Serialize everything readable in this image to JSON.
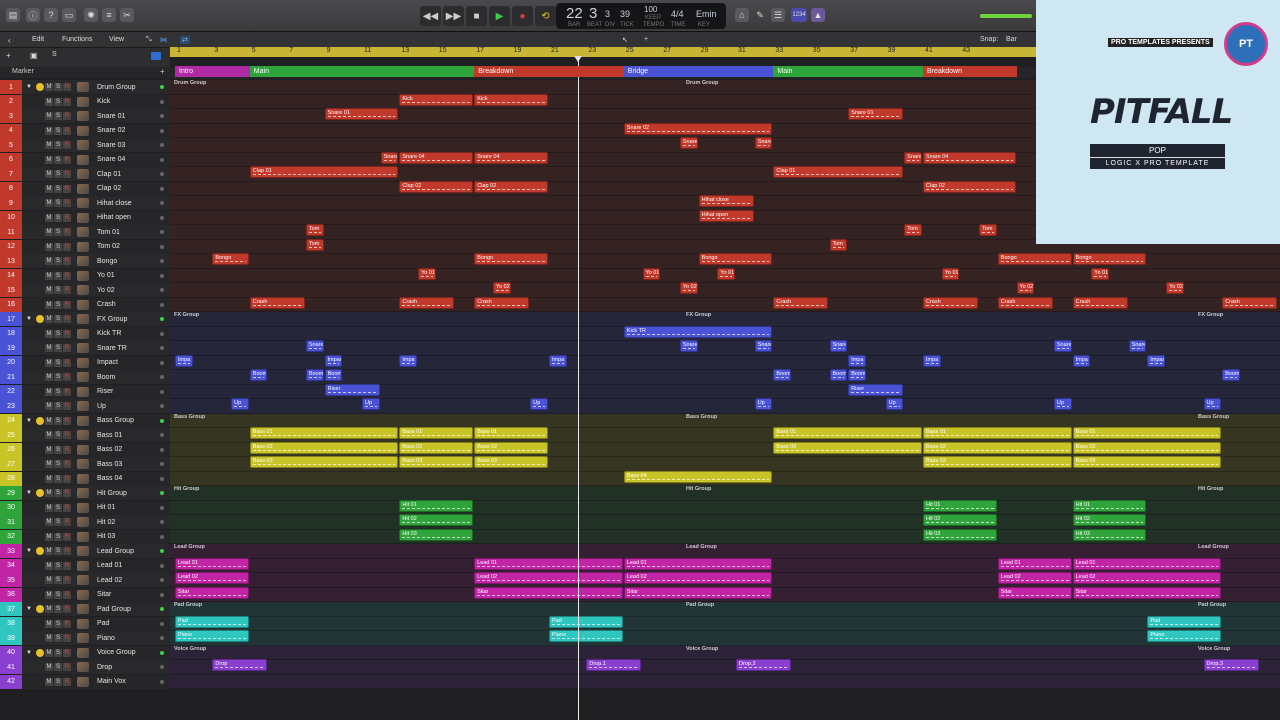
{
  "toolbar": {
    "edit": "Edit",
    "functions": "Functions",
    "view": "View",
    "snap_label": "Snap:",
    "snap_value": "Bar",
    "s_btn": "S"
  },
  "lcd": {
    "bar": "22",
    "beat": "3",
    "div": "3",
    "tick": "39",
    "tempo": "100",
    "tempo_mode": "KEEP",
    "sig": "4/4",
    "key": "Emin",
    "bar_l": "BAR",
    "beat_l": "BEAT",
    "div_l": "DIV",
    "tick_l": "TICK",
    "tempo_l": "TEMPO",
    "time_l": "TIME",
    "key_l": "KEY"
  },
  "cbar": {
    "count_in": "1234"
  },
  "ruler": {
    "labels": [
      "1",
      "3",
      "5",
      "7",
      "9",
      "11",
      "13",
      "15",
      "17",
      "19",
      "21",
      "23",
      "25",
      "27",
      "29",
      "31",
      "33",
      "35",
      "37",
      "39",
      "41",
      "43"
    ],
    "marker_title": "Marker"
  },
  "markers": [
    {
      "label": "Intro",
      "start": 1,
      "end": 5,
      "color": "#b02aa6"
    },
    {
      "label": "Main",
      "start": 5,
      "end": 17,
      "color": "#2ea43a"
    },
    {
      "label": "Breakdown",
      "start": 17,
      "end": 25,
      "color": "#c0392b"
    },
    {
      "label": "Bridge",
      "start": 25,
      "end": 33,
      "color": "#4a52d6"
    },
    {
      "label": "Main",
      "start": 33,
      "end": 41,
      "color": "#2ea43a"
    },
    {
      "label": "Breakdown",
      "start": 41,
      "end": 46,
      "color": "#c0392b"
    }
  ],
  "tracks": [
    {
      "n": "1",
      "name": "Drum Group",
      "c": "#c0392b",
      "folder": true
    },
    {
      "n": "2",
      "name": "Kick",
      "c": "#c0392b"
    },
    {
      "n": "3",
      "name": "Snare 01",
      "c": "#c0392b"
    },
    {
      "n": "4",
      "name": "Snare 02",
      "c": "#c0392b"
    },
    {
      "n": "5",
      "name": "Snare 03",
      "c": "#c0392b"
    },
    {
      "n": "6",
      "name": "Snare 04",
      "c": "#c0392b"
    },
    {
      "n": "7",
      "name": "Clap 01",
      "c": "#c0392b"
    },
    {
      "n": "8",
      "name": "Clap 02",
      "c": "#c0392b"
    },
    {
      "n": "9",
      "name": "Hihat close",
      "c": "#c0392b"
    },
    {
      "n": "10",
      "name": "Hihat open",
      "c": "#c0392b"
    },
    {
      "n": "11",
      "name": "Tom 01",
      "c": "#c0392b"
    },
    {
      "n": "12",
      "name": "Tom 02",
      "c": "#c0392b"
    },
    {
      "n": "13",
      "name": "Bongo",
      "c": "#c0392b"
    },
    {
      "n": "14",
      "name": "Yo 01",
      "c": "#c0392b"
    },
    {
      "n": "15",
      "name": "Yo 02",
      "c": "#c0392b"
    },
    {
      "n": "16",
      "name": "Crash",
      "c": "#c0392b"
    },
    {
      "n": "17",
      "name": "FX Group",
      "c": "#4a52d6",
      "folder": true
    },
    {
      "n": "18",
      "name": "Kick TR",
      "c": "#4a52d6"
    },
    {
      "n": "19",
      "name": "Snare TR",
      "c": "#4a52d6"
    },
    {
      "n": "20",
      "name": "Impact",
      "c": "#4a52d6"
    },
    {
      "n": "21",
      "name": "Boom",
      "c": "#4a52d6"
    },
    {
      "n": "22",
      "name": "Riser",
      "c": "#4a52d6"
    },
    {
      "n": "23",
      "name": "Up",
      "c": "#4a52d6"
    },
    {
      "n": "24",
      "name": "Bass Group",
      "c": "#c8c428",
      "folder": true
    },
    {
      "n": "25",
      "name": "Bass 01",
      "c": "#c8c428"
    },
    {
      "n": "26",
      "name": "Bass 02",
      "c": "#c8c428"
    },
    {
      "n": "27",
      "name": "Bass 03",
      "c": "#c8c428"
    },
    {
      "n": "28",
      "name": "Bass 04",
      "c": "#c8c428"
    },
    {
      "n": "29",
      "name": "Hit Group",
      "c": "#2ea43a",
      "folder": true
    },
    {
      "n": "30",
      "name": "Hit 01",
      "c": "#2ea43a"
    },
    {
      "n": "31",
      "name": "Hit 02",
      "c": "#2ea43a"
    },
    {
      "n": "32",
      "name": "Hit 03",
      "c": "#2ea43a"
    },
    {
      "n": "33",
      "name": "Lead Group",
      "c": "#c224a6",
      "folder": true
    },
    {
      "n": "34",
      "name": "Lead 01",
      "c": "#c224a6"
    },
    {
      "n": "35",
      "name": "Lead 02",
      "c": "#c224a6"
    },
    {
      "n": "36",
      "name": "Sitar",
      "c": "#c224a6"
    },
    {
      "n": "37",
      "name": "Pad Group",
      "c": "#2fc6c0",
      "folder": true
    },
    {
      "n": "38",
      "name": "Pad",
      "c": "#2fc6c0"
    },
    {
      "n": "39",
      "name": "Piano",
      "c": "#2fc6c0"
    },
    {
      "n": "40",
      "name": "Voice Group",
      "c": "#8a3fd1",
      "folder": true
    },
    {
      "n": "41",
      "name": "Drop",
      "c": "#8a3fd1"
    },
    {
      "n": "42",
      "name": "Main Vox",
      "c": "#8a3fd1"
    }
  ],
  "group_labels": [
    {
      "row": 0,
      "text": "Drum Group"
    },
    {
      "row": 16,
      "text": "FX Group"
    },
    {
      "row": 23,
      "text": "Bass Group"
    },
    {
      "row": 28,
      "text": "Hit Group"
    },
    {
      "row": 32,
      "text": "Lead Group"
    },
    {
      "row": 36,
      "text": "Pad Group"
    },
    {
      "row": 39,
      "text": "Voice Group"
    }
  ],
  "regions": [
    {
      "r": 1,
      "s": 13,
      "e": 17,
      "t": "Kick"
    },
    {
      "r": 1,
      "s": 17,
      "e": 21,
      "t": "Kick"
    },
    {
      "r": 2,
      "s": 9,
      "e": 13,
      "t": "Snare 01"
    },
    {
      "r": 2,
      "s": 37,
      "e": 40,
      "t": "Snare 01"
    },
    {
      "r": 3,
      "s": 25,
      "e": 33,
      "t": "Snare 02"
    },
    {
      "r": 4,
      "s": 28,
      "e": 29,
      "t": "Snare"
    },
    {
      "r": 4,
      "s": 32,
      "e": 33,
      "t": "Snare"
    },
    {
      "r": 5,
      "s": 12,
      "e": 13,
      "t": "Snare"
    },
    {
      "r": 5,
      "s": 13,
      "e": 17,
      "t": "Snare 04"
    },
    {
      "r": 5,
      "s": 17,
      "e": 21,
      "t": "Snare 04"
    },
    {
      "r": 5,
      "s": 40,
      "e": 41,
      "t": "Snare"
    },
    {
      "r": 5,
      "s": 41,
      "e": 46,
      "t": "Snare 04"
    },
    {
      "r": 6,
      "s": 5,
      "e": 13,
      "t": "Clap 01"
    },
    {
      "r": 6,
      "s": 33,
      "e": 40,
      "t": "Clap 01"
    },
    {
      "r": 7,
      "s": 13,
      "e": 17,
      "t": "Clap 02"
    },
    {
      "r": 7,
      "s": 17,
      "e": 21,
      "t": "Clap 02"
    },
    {
      "r": 7,
      "s": 41,
      "e": 46,
      "t": "Clap 02"
    },
    {
      "r": 8,
      "s": 29,
      "e": 32,
      "t": "Hihat close"
    },
    {
      "r": 9,
      "s": 29,
      "e": 32,
      "t": "Hihat open"
    },
    {
      "r": 10,
      "s": 8,
      "e": 9,
      "t": "Tom"
    },
    {
      "r": 10,
      "s": 40,
      "e": 41,
      "t": "Tom"
    },
    {
      "r": 10,
      "s": 44,
      "e": 45,
      "t": "Tom"
    },
    {
      "r": 11,
      "s": 8,
      "e": 9,
      "t": "Tom"
    },
    {
      "r": 11,
      "s": 36,
      "e": 37,
      "t": "Tom"
    },
    {
      "r": 12,
      "s": 3,
      "e": 5,
      "t": "Bongo"
    },
    {
      "r": 12,
      "s": 17,
      "e": 21,
      "t": "Bongo"
    },
    {
      "r": 12,
      "s": 29,
      "e": 33,
      "t": "Bongo"
    },
    {
      "r": 12,
      "s": 45,
      "e": 49,
      "t": "Bongo"
    },
    {
      "r": 12,
      "s": 49,
      "e": 53,
      "t": "Bongo"
    },
    {
      "r": 13,
      "s": 14,
      "e": 15,
      "t": "Yo 01"
    },
    {
      "r": 13,
      "s": 26,
      "e": 27,
      "t": "Yo 01"
    },
    {
      "r": 13,
      "s": 30,
      "e": 31,
      "t": "Yo 01"
    },
    {
      "r": 13,
      "s": 42,
      "e": 43,
      "t": "Yo 01"
    },
    {
      "r": 13,
      "s": 50,
      "e": 51,
      "t": "Yo 01"
    },
    {
      "r": 14,
      "s": 18,
      "e": 19,
      "t": "Yo 02"
    },
    {
      "r": 14,
      "s": 28,
      "e": 29,
      "t": "Yo 02"
    },
    {
      "r": 14,
      "s": 46,
      "e": 47,
      "t": "Yo 02"
    },
    {
      "r": 14,
      "s": 54,
      "e": 55,
      "t": "Yo 02"
    },
    {
      "r": 15,
      "s": 5,
      "e": 8,
      "t": "Crash"
    },
    {
      "r": 15,
      "s": 13,
      "e": 16,
      "t": "Crash"
    },
    {
      "r": 15,
      "s": 17,
      "e": 20,
      "t": "Crash"
    },
    {
      "r": 15,
      "s": 33,
      "e": 36,
      "t": "Crash"
    },
    {
      "r": 15,
      "s": 41,
      "e": 44,
      "t": "Crash"
    },
    {
      "r": 15,
      "s": 45,
      "e": 48,
      "t": "Crash"
    },
    {
      "r": 15,
      "s": 49,
      "e": 52,
      "t": "Crash"
    },
    {
      "r": 15,
      "s": 57,
      "e": 60,
      "t": "Crash"
    },
    {
      "r": 17,
      "s": 25,
      "e": 33,
      "t": "Kick TR"
    },
    {
      "r": 18,
      "s": 8,
      "e": 9,
      "t": "Snare"
    },
    {
      "r": 18,
      "s": 28,
      "e": 29,
      "t": "Snare"
    },
    {
      "r": 18,
      "s": 32,
      "e": 33,
      "t": "Snare"
    },
    {
      "r": 18,
      "s": 36,
      "e": 37,
      "t": "Snare"
    },
    {
      "r": 18,
      "s": 48,
      "e": 49,
      "t": "Snare"
    },
    {
      "r": 18,
      "s": 52,
      "e": 53,
      "t": "Snare"
    },
    {
      "r": 19,
      "s": 1,
      "e": 2,
      "t": "Impa"
    },
    {
      "r": 19,
      "s": 9,
      "e": 10,
      "t": "Impac"
    },
    {
      "r": 19,
      "s": 13,
      "e": 14,
      "t": "Impa"
    },
    {
      "r": 19,
      "s": 21,
      "e": 22,
      "t": "Impa"
    },
    {
      "r": 19,
      "s": 37,
      "e": 38,
      "t": "Impa"
    },
    {
      "r": 19,
      "s": 41,
      "e": 42,
      "t": "Impa"
    },
    {
      "r": 19,
      "s": 49,
      "e": 50,
      "t": "Impa"
    },
    {
      "r": 19,
      "s": 53,
      "e": 54,
      "t": "Impac"
    },
    {
      "r": 20,
      "s": 5,
      "e": 6,
      "t": "Boom"
    },
    {
      "r": 20,
      "s": 8,
      "e": 9,
      "t": "Boom"
    },
    {
      "r": 20,
      "s": 9,
      "e": 10,
      "t": "Boom"
    },
    {
      "r": 20,
      "s": 33,
      "e": 34,
      "t": "Boom"
    },
    {
      "r": 20,
      "s": 36,
      "e": 37,
      "t": "Boom"
    },
    {
      "r": 20,
      "s": 37,
      "e": 38,
      "t": "Boom"
    },
    {
      "r": 20,
      "s": 57,
      "e": 58,
      "t": "Boom"
    },
    {
      "r": 21,
      "s": 9,
      "e": 12,
      "t": "Riser"
    },
    {
      "r": 21,
      "s": 37,
      "e": 40,
      "t": "Riser"
    },
    {
      "r": 22,
      "s": 4,
      "e": 5,
      "t": "Up"
    },
    {
      "r": 22,
      "s": 11,
      "e": 12,
      "t": "Up"
    },
    {
      "r": 22,
      "s": 20,
      "e": 21,
      "t": "Up"
    },
    {
      "r": 22,
      "s": 32,
      "e": 33,
      "t": "Up"
    },
    {
      "r": 22,
      "s": 39,
      "e": 40,
      "t": "Up"
    },
    {
      "r": 22,
      "s": 48,
      "e": 49,
      "t": "Up"
    },
    {
      "r": 22,
      "s": 56,
      "e": 57,
      "t": "Up"
    },
    {
      "r": 24,
      "s": 5,
      "e": 13,
      "t": "Bass 01"
    },
    {
      "r": 24,
      "s": 13,
      "e": 17,
      "t": "Bass 01"
    },
    {
      "r": 24,
      "s": 17,
      "e": 21,
      "t": "Bass 01"
    },
    {
      "r": 24,
      "s": 33,
      "e": 41,
      "t": "Bass 01"
    },
    {
      "r": 24,
      "s": 41,
      "e": 49,
      "t": "Bass 01"
    },
    {
      "r": 24,
      "s": 49,
      "e": 57,
      "t": "Bass 01"
    },
    {
      "r": 25,
      "s": 5,
      "e": 13,
      "t": "Bass 02"
    },
    {
      "r": 25,
      "s": 13,
      "e": 17,
      "t": "Bass 02"
    },
    {
      "r": 25,
      "s": 17,
      "e": 21,
      "t": "Bass 02"
    },
    {
      "r": 25,
      "s": 33,
      "e": 41,
      "t": "Bass 02"
    },
    {
      "r": 25,
      "s": 41,
      "e": 49,
      "t": "Bass 02"
    },
    {
      "r": 25,
      "s": 49,
      "e": 57,
      "t": "Bass 02"
    },
    {
      "r": 26,
      "s": 5,
      "e": 13,
      "t": "Bass 03"
    },
    {
      "r": 26,
      "s": 13,
      "e": 17,
      "t": "Bass 03"
    },
    {
      "r": 26,
      "s": 17,
      "e": 21,
      "t": "Bass 03"
    },
    {
      "r": 26,
      "s": 41,
      "e": 49,
      "t": "Bass 03"
    },
    {
      "r": 26,
      "s": 49,
      "e": 57,
      "t": "Bass 03"
    },
    {
      "r": 27,
      "s": 25,
      "e": 33,
      "t": "Bass 04"
    },
    {
      "r": 29,
      "s": 13,
      "e": 17,
      "t": "Hit 01"
    },
    {
      "r": 29,
      "s": 41,
      "e": 45,
      "t": "Hit 01"
    },
    {
      "r": 29,
      "s": 49,
      "e": 53,
      "t": "Hit 01"
    },
    {
      "r": 30,
      "s": 13,
      "e": 17,
      "t": "Hit 02"
    },
    {
      "r": 30,
      "s": 41,
      "e": 45,
      "t": "Hit 02"
    },
    {
      "r": 30,
      "s": 49,
      "e": 53,
      "t": "Hit 02"
    },
    {
      "r": 31,
      "s": 13,
      "e": 17,
      "t": "Hit 03"
    },
    {
      "r": 31,
      "s": 41,
      "e": 45,
      "t": "Hit 03"
    },
    {
      "r": 31,
      "s": 49,
      "e": 53,
      "t": "Hit 03"
    },
    {
      "r": 33,
      "s": 1,
      "e": 5,
      "t": "Lead 01"
    },
    {
      "r": 33,
      "s": 17,
      "e": 25,
      "t": "Lead 01"
    },
    {
      "r": 33,
      "s": 25,
      "e": 33,
      "t": "Lead 01"
    },
    {
      "r": 33,
      "s": 45,
      "e": 49,
      "t": "Lead 01"
    },
    {
      "r": 33,
      "s": 49,
      "e": 57,
      "t": "Lead 01"
    },
    {
      "r": 34,
      "s": 1,
      "e": 5,
      "t": "Lead 02"
    },
    {
      "r": 34,
      "s": 17,
      "e": 25,
      "t": "Lead 02"
    },
    {
      "r": 34,
      "s": 25,
      "e": 33,
      "t": "Lead 02"
    },
    {
      "r": 34,
      "s": 45,
      "e": 49,
      "t": "Lead 02"
    },
    {
      "r": 34,
      "s": 49,
      "e": 57,
      "t": "Lead 02"
    },
    {
      "r": 35,
      "s": 1,
      "e": 5,
      "t": "Sitar"
    },
    {
      "r": 35,
      "s": 17,
      "e": 25,
      "t": "Sitar"
    },
    {
      "r": 35,
      "s": 25,
      "e": 33,
      "t": "Sitar"
    },
    {
      "r": 35,
      "s": 45,
      "e": 49,
      "t": "Sitar"
    },
    {
      "r": 35,
      "s": 49,
      "e": 57,
      "t": "Sitar"
    },
    {
      "r": 37,
      "s": 1,
      "e": 5,
      "t": "Pad"
    },
    {
      "r": 37,
      "s": 21,
      "e": 25,
      "t": "Pad"
    },
    {
      "r": 37,
      "s": 53,
      "e": 57,
      "t": "Pad"
    },
    {
      "r": 38,
      "s": 1,
      "e": 5,
      "t": "Piano"
    },
    {
      "r": 38,
      "s": 21,
      "e": 25,
      "t": "Piano"
    },
    {
      "r": 38,
      "s": 53,
      "e": 57,
      "t": "Piano"
    },
    {
      "r": 40,
      "s": 3,
      "e": 6,
      "t": "Drop"
    },
    {
      "r": 40,
      "s": 23,
      "e": 26,
      "t": "Drop.1"
    },
    {
      "r": 40,
      "s": 31,
      "e": 34,
      "t": "Drop.2"
    },
    {
      "r": 40,
      "s": 56,
      "e": 59,
      "t": "Drop.3"
    }
  ],
  "promo": {
    "presents": "PRO TEMPLATES PRESENTS",
    "logo": "PT",
    "title": "PITFALL",
    "genre": "POP",
    "product": "LOGIC X PRO TEMPLATE"
  }
}
